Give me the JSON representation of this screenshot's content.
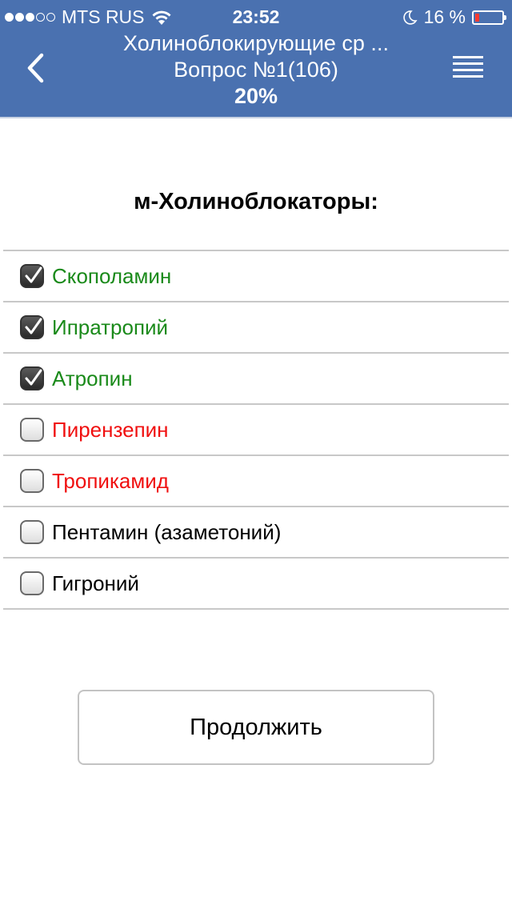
{
  "status_bar": {
    "carrier": "MTS RUS",
    "time": "23:52",
    "battery_percent_text": "16 %",
    "battery_level": 0.16,
    "signal_bars_filled": 3,
    "signal_bars_total": 5,
    "battery_color": "#ff3b30"
  },
  "header": {
    "title": "Холиноблокирующие ср ...",
    "subtitle": "Вопрос №1(106)",
    "progress": "20%",
    "back_icon": "chevron-left-icon",
    "menu_icon": "hamburger-menu-icon",
    "background_color": "#4a71b0"
  },
  "question": {
    "text": "м-Холиноблокаторы:"
  },
  "options": [
    {
      "label": "Скополамин",
      "checked": true,
      "color": "#1a8a1a"
    },
    {
      "label": "Ипратропий",
      "checked": true,
      "color": "#1a8a1a"
    },
    {
      "label": "Атропин",
      "checked": true,
      "color": "#1a8a1a"
    },
    {
      "label": "Пирензепин",
      "checked": false,
      "color": "#f01010"
    },
    {
      "label": "Тропикамид",
      "checked": false,
      "color": "#f01010"
    },
    {
      "label": "Пентамин (азаметоний)",
      "checked": false,
      "color": "#000000"
    },
    {
      "label": "Гигроний",
      "checked": false,
      "color": "#000000"
    }
  ],
  "actions": {
    "continue_label": "Продолжить"
  }
}
